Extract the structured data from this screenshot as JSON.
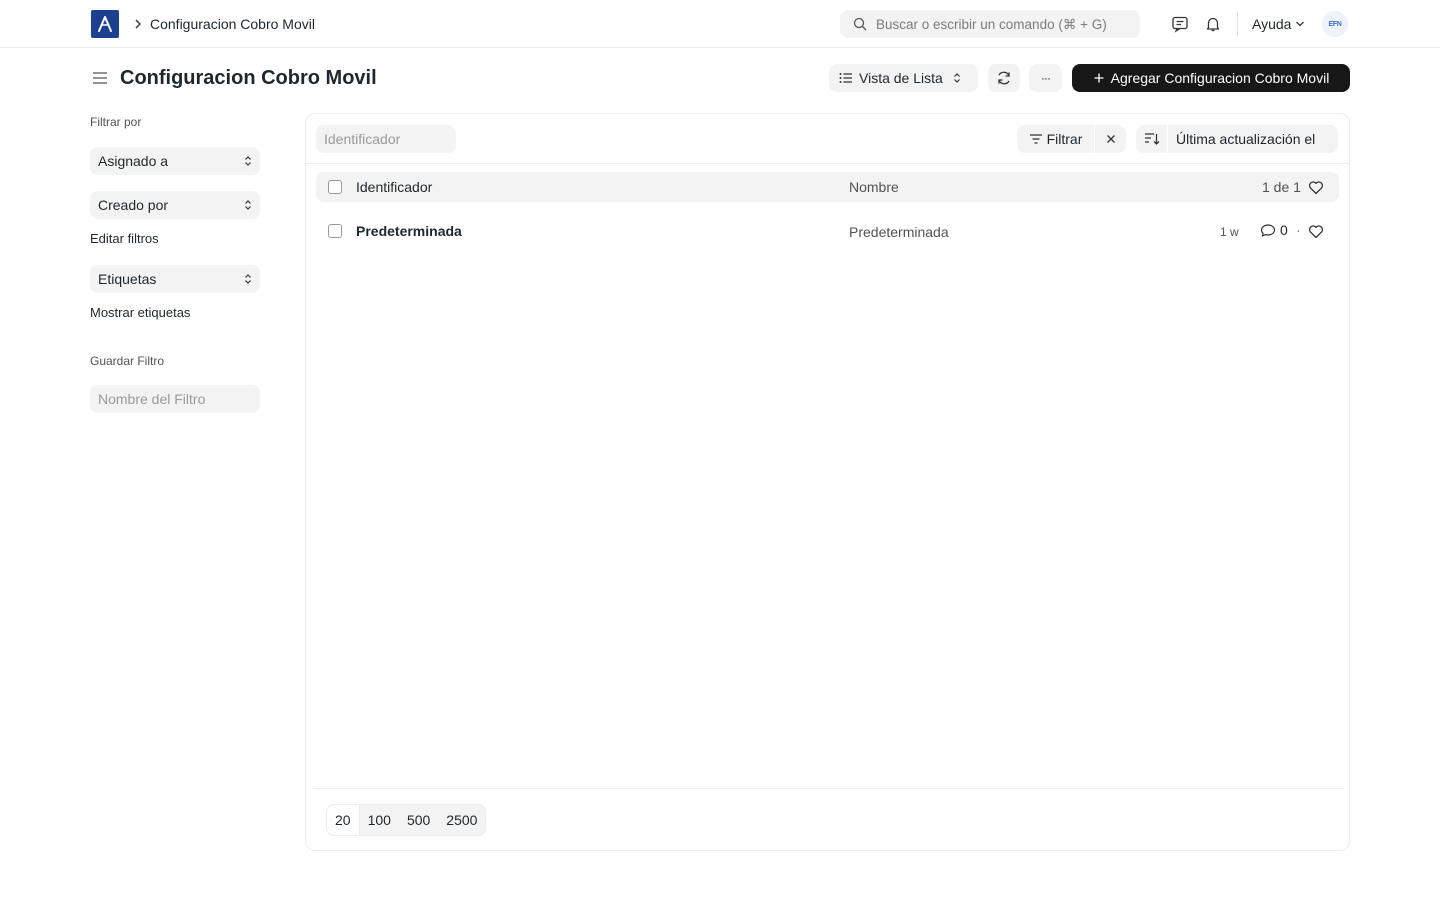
{
  "navbar": {
    "breadcrumb": "Configuracion Cobro Movil",
    "search_placeholder": "Buscar o escribir un comando (⌘ + G)",
    "help_label": "Ayuda"
  },
  "page": {
    "title": "Configuracion Cobro Movil",
    "view_label": "Vista de Lista",
    "more_label": "···",
    "add_label": "Agregar Configuracion Cobro Movil"
  },
  "sidebar": {
    "filter_by": "Filtrar por",
    "assigned_to": "Asignado a",
    "created_by": "Creado por",
    "edit_filters": "Editar filtros",
    "tags": "Etiquetas",
    "show_tags": "Mostrar etiquetas",
    "save_filter": "Guardar Filtro",
    "filter_name_placeholder": "Nombre del Filtro"
  },
  "filters": {
    "identifier_placeholder": "Identificador",
    "filter_label": "Filtrar",
    "sort_label": "Última actualización el"
  },
  "list": {
    "columns": {
      "identifier": "Identificador",
      "name": "Nombre"
    },
    "count": "1 de 1",
    "rows": [
      {
        "identifier": "Predeterminada",
        "name": "Predeterminada",
        "modified": "1 w",
        "comments": "0"
      }
    ]
  },
  "pager": {
    "sizes": [
      "20",
      "100",
      "500",
      "2500"
    ]
  },
  "colors": {
    "brand": "#1c3f8f",
    "primary_button": "#171717",
    "surface": "#f3f3f3"
  }
}
